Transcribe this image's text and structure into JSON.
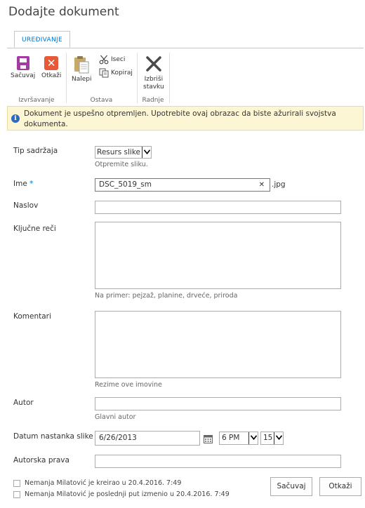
{
  "page_title": "Dodajte dokument",
  "ribbon": {
    "tab": "UREĐIVANJE",
    "groups": {
      "commit": {
        "label": "Izvršavanje",
        "save": "Sačuvaj",
        "cancel": "Otkaži"
      },
      "clipboard": {
        "label": "Ostava",
        "paste": "Nalepi",
        "cut": "Iseci",
        "copy": "Kopiraj"
      },
      "actions": {
        "label": "Radnje",
        "delete_line1": "Izbriši",
        "delete_line2": "stavku"
      }
    }
  },
  "message": "Dokument je uspešno otpremljen. Upotrebite ovaj obrazac da biste ažurirali svojstva dokumenta.",
  "form": {
    "content_type": {
      "label": "Tip sadržaja",
      "value": "Resurs slike",
      "hint": "Otpremite sliku."
    },
    "name": {
      "label": "Ime",
      "required_mark": "*",
      "value": "DSC_5019_sm",
      "extension": ".jpg",
      "clear": "✕"
    },
    "title": {
      "label": "Naslov",
      "value": ""
    },
    "keywords": {
      "label": "Ključne reči",
      "value": "",
      "hint": "Na primer: pejzaž, planine, drveće, priroda"
    },
    "comments": {
      "label": "Komentari",
      "value": "",
      "hint": "Rezime ove imovine"
    },
    "author": {
      "label": "Autor",
      "value": "",
      "hint": "Glavni autor"
    },
    "date_created": {
      "label": "Datum nastanka slike",
      "date": "6/26/2013",
      "hour": "6 PM",
      "minute": "15"
    },
    "copyright": {
      "label": "Autorska prava",
      "value": ""
    }
  },
  "footer": {
    "created": "Nemanja Milatović je kreirao u 20.4.2016. 7:49",
    "modified": "Nemanja Milatović je poslednji put izmenio u 20.4.2016. 7:49"
  },
  "buttons": {
    "save": "Sačuvaj",
    "cancel": "Otkaži"
  },
  "colors": {
    "accent": "#0072c6",
    "save_icon": "#a53aa3",
    "cancel_icon": "#e65a3a",
    "message_bg": "#fdf6d5"
  }
}
